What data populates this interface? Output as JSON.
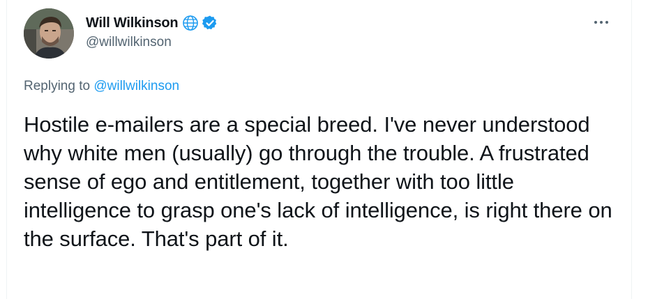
{
  "author": {
    "name": "Will Wilkinson",
    "handle": "@willwilkinson",
    "avatar_icon": "avatar-photo",
    "globe_icon": "globe-icon",
    "verified_icon": "verified-badge-icon"
  },
  "menu": {
    "icon": "more-options-icon"
  },
  "reply": {
    "prefix": "Replying to",
    "mention": "@willwilkinson"
  },
  "tweet": {
    "text": "Hostile e-mailers are a special breed. I've never understood why white men (usually) go through the trouble. A frustrated sense of ego and entitlement, together with too little intelligence to grasp one's lack of intelligence, is right there on the surface. That's part of it."
  },
  "colors": {
    "text": "#0f1419",
    "secondary": "#536471",
    "accent": "#1d9bf0"
  }
}
